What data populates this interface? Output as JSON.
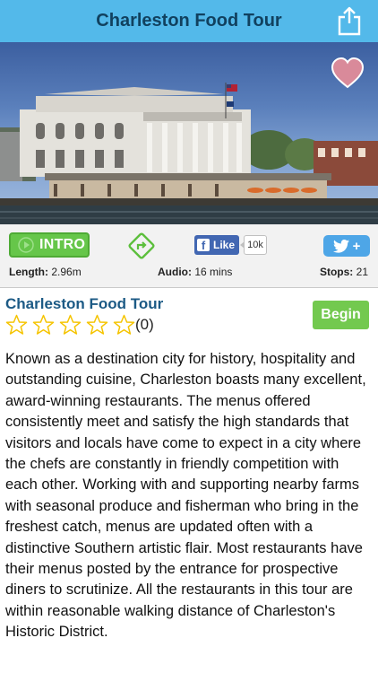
{
  "header": {
    "title": "Charleston Food Tour",
    "share_icon": "share-icon"
  },
  "hero": {
    "favorite_icon": "heart-icon"
  },
  "actions": {
    "intro_label": "INTRO",
    "directions_icon": "directions-icon",
    "facebook": {
      "like_label": "Like",
      "count": "10k"
    },
    "twitter": {
      "plus_label": "+"
    }
  },
  "stats": {
    "length_label": "Length:",
    "length_value": "2.96m",
    "audio_label": "Audio:",
    "audio_value": "16 mins",
    "stops_label": "Stops:",
    "stops_value": "21"
  },
  "tour": {
    "title": "Charleston Food Tour",
    "rating_stars_filled": 0,
    "rating_stars_total": 5,
    "rating_count": "(0)",
    "begin_label": "Begin",
    "description": "Known as a destination city for history, hospitality and outstanding cuisine, Charleston boasts many excellent, award-winning restaurants. The menus offered consistently meet and satisfy the high standards that visitors and locals have come to expect in a city where the chefs are constantly in friendly competition with each other. Working with and supporting nearby farms with seasonal produce and fisherman who bring in the freshest catch, menus are updated often with a distinctive Southern artistic flair. Most restaurants have their menus posted by the entrance for prospective diners to scrutinize. All the restaurants in this tour are within reasonable walking distance of Charleston's Historic District."
  },
  "colors": {
    "header_bg": "#53b9ea",
    "title_color": "#11415f",
    "intro_green": "#66c64a",
    "begin_green": "#73c94f",
    "facebook_blue": "#4267b2",
    "twitter_blue": "#4ea6e7",
    "star_yellow": "#f5c400"
  }
}
